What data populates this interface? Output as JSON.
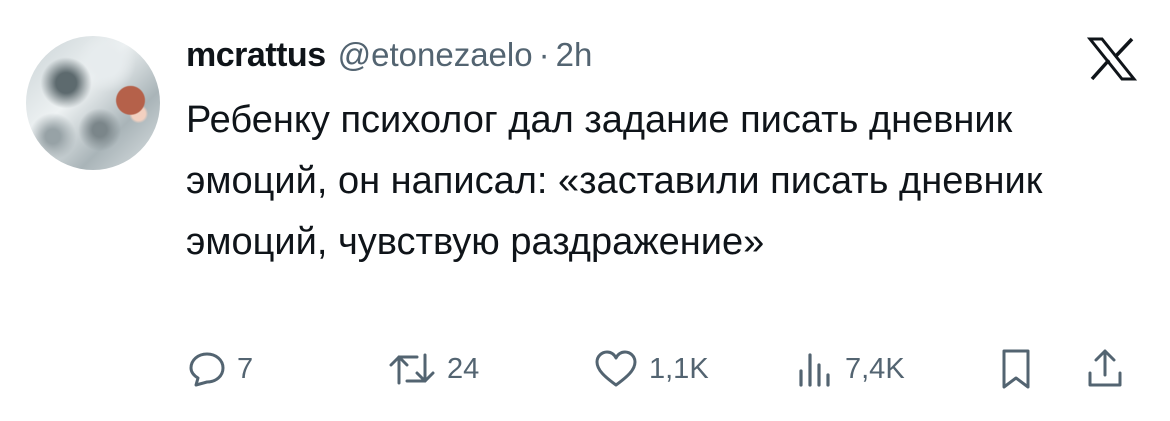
{
  "tweet": {
    "username": "mcrattus",
    "handle": "@etonezaelo",
    "separator": "·",
    "time": "2h",
    "text": "Ребенку психолог дал задание писать дневник эмоций, он написал: «заставили писать дневник эмоций, чувствую раздражение»"
  },
  "actions": {
    "replies": "7",
    "retweets": "24",
    "likes": "1,1K",
    "views": "7,4K"
  },
  "icons": {
    "avatar": "profile-photo",
    "logo": "x-logo-icon",
    "reply": "reply-icon",
    "retweet": "retweet-icon",
    "like": "heart-icon",
    "views": "views-icon",
    "bookmark": "bookmark-icon",
    "share": "share-icon"
  },
  "colors": {
    "text": "#0f1419",
    "secondary": "#536471"
  }
}
